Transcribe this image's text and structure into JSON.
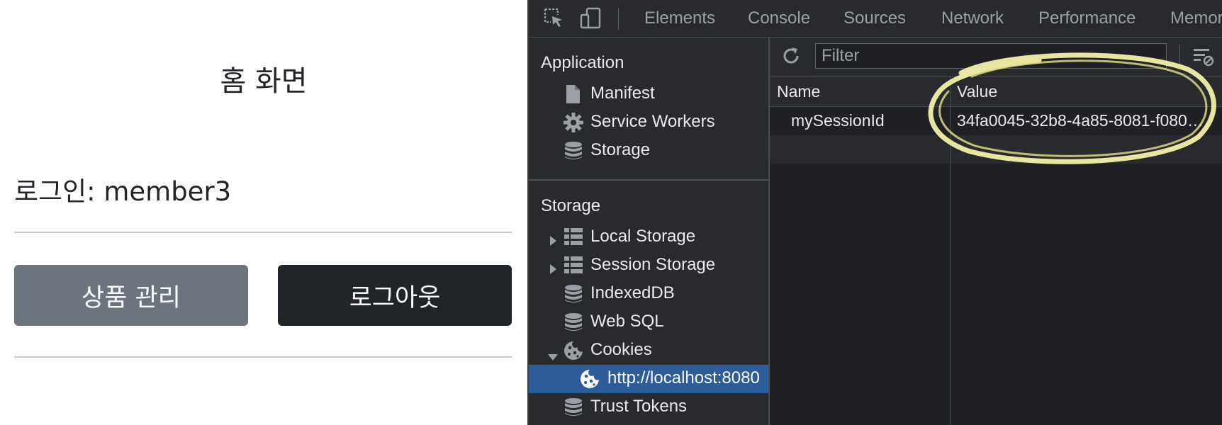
{
  "page": {
    "title": "홈 화면",
    "login_text": "로그인: member3",
    "buttons": {
      "items": "상품 관리",
      "logout": "로그아웃"
    },
    "colors": {
      "secondary": "#6c757d",
      "dark": "#212529"
    }
  },
  "devtools": {
    "tabs": [
      "Elements",
      "Console",
      "Sources",
      "Network",
      "Performance",
      "Memor"
    ],
    "toolbar_icons": [
      "inspect-element-icon",
      "device-toggle-icon"
    ],
    "sidebar": {
      "application_header": "Application",
      "application_items": [
        {
          "label": "Manifest",
          "icon": "file-icon"
        },
        {
          "label": "Service Workers",
          "icon": "gear-icon"
        },
        {
          "label": "Storage",
          "icon": "database-icon"
        }
      ],
      "storage_header": "Storage",
      "storage_items": [
        {
          "label": "Local Storage",
          "icon": "table-icon",
          "expander": "collapsed"
        },
        {
          "label": "Session Storage",
          "icon": "table-icon",
          "expander": "collapsed"
        },
        {
          "label": "IndexedDB",
          "icon": "database-icon"
        },
        {
          "label": "Web SQL",
          "icon": "database-icon"
        },
        {
          "label": "Cookies",
          "icon": "cookie-icon",
          "expander": "expanded"
        },
        {
          "label": "http://localhost:8080",
          "icon": "cookie-icon",
          "selected": true
        },
        {
          "label": "Trust Tokens",
          "icon": "database-icon"
        }
      ]
    },
    "filter": {
      "placeholder": "Filter"
    },
    "table": {
      "headers": {
        "name": "Name",
        "value": "Value"
      },
      "rows": [
        {
          "name": "mySessionId",
          "value": "34fa0045-32b8-4a85-8081-f080…"
        }
      ]
    },
    "annotation": {
      "shape": "hand-drawn ellipse",
      "color": "#f3f0a8"
    }
  }
}
